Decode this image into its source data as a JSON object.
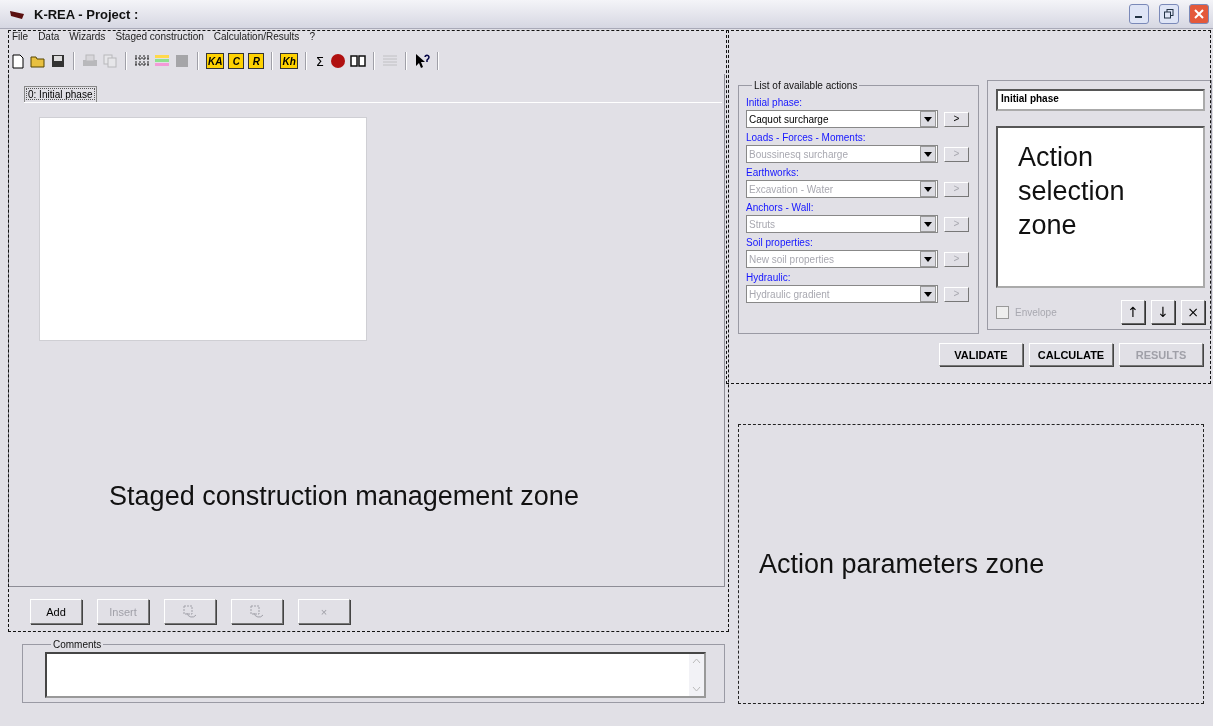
{
  "window": {
    "title": "K-REA - Project :"
  },
  "menu": [
    "File",
    "Data",
    "Wizards",
    "Staged construction",
    "Calculation/Results",
    "?"
  ],
  "toolbar": [
    {
      "kind": "icon",
      "disabled": false
    },
    {
      "kind": "icon",
      "disabled": false
    },
    {
      "kind": "icon",
      "disabled": false
    },
    {
      "kind": "separator"
    },
    {
      "kind": "icon",
      "disabled": true
    },
    {
      "kind": "icon",
      "disabled": true
    },
    {
      "kind": "separator"
    },
    {
      "kind": "icon",
      "disabled": false
    },
    {
      "kind": "icon",
      "disabled": false
    },
    {
      "kind": "icon",
      "disabled": false
    },
    {
      "kind": "separator"
    },
    {
      "kind": "key",
      "label": "KA"
    },
    {
      "kind": "key",
      "label": "C"
    },
    {
      "kind": "key",
      "label": "R"
    },
    {
      "kind": "separator"
    },
    {
      "kind": "key",
      "label": "Kh"
    },
    {
      "kind": "separator"
    },
    {
      "kind": "text",
      "label": "Σ"
    },
    {
      "kind": "icon",
      "disabled": false
    },
    {
      "kind": "icon",
      "disabled": false
    },
    {
      "kind": "separator"
    },
    {
      "kind": "icon",
      "disabled": true
    },
    {
      "kind": "separator"
    },
    {
      "kind": "icon",
      "disabled": false
    },
    {
      "kind": "separator"
    }
  ],
  "phase_tabs": [
    {
      "label": "0: Initial phase",
      "selected": true
    }
  ],
  "management_zone": {
    "label": "Staged construction management zone"
  },
  "phase_buttons": [
    {
      "kind": "text",
      "label": "Add",
      "disabled": false
    },
    {
      "kind": "text",
      "label": "Insert",
      "disabled": true
    },
    {
      "kind": "icon",
      "disabled": true
    },
    {
      "kind": "icon",
      "disabled": true
    },
    {
      "kind": "text",
      "label": "×",
      "disabled": true
    }
  ],
  "comments": {
    "title": "Comments"
  },
  "actions": {
    "title": "List of available actions",
    "groups": [
      {
        "label": "Initial phase:",
        "value": "Caquot surcharge",
        "go": ">",
        "disabled": false
      },
      {
        "label": "Loads - Forces - Moments:",
        "value": "Boussinesq surcharge",
        "go": ">",
        "disabled": true
      },
      {
        "label": "Earthworks:",
        "value": "Excavation - Water",
        "go": ">",
        "disabled": true
      },
      {
        "label": "Anchors - Wall:",
        "value": "Struts",
        "go": ">",
        "disabled": true
      },
      {
        "label": "Soil properties:",
        "value": "New soil properties",
        "go": ">",
        "disabled": true
      },
      {
        "label": "Hydraulic:",
        "value": "Hydraulic gradient",
        "go": ">",
        "disabled": true
      }
    ]
  },
  "selection": {
    "phase_name": "Initial phase",
    "zone_label": "Action selection zone",
    "envelope": {
      "label": "Envelope",
      "checked": false,
      "disabled": true
    },
    "order_buttons": [
      "↑",
      "↓",
      "×"
    ]
  },
  "main_buttons": [
    {
      "label": "VALIDATE",
      "disabled": false
    },
    {
      "label": "CALCULATE",
      "disabled": false
    },
    {
      "label": "RESULTS",
      "disabled": true
    }
  ],
  "parameters_zone": {
    "label": "Action parameters zone"
  }
}
